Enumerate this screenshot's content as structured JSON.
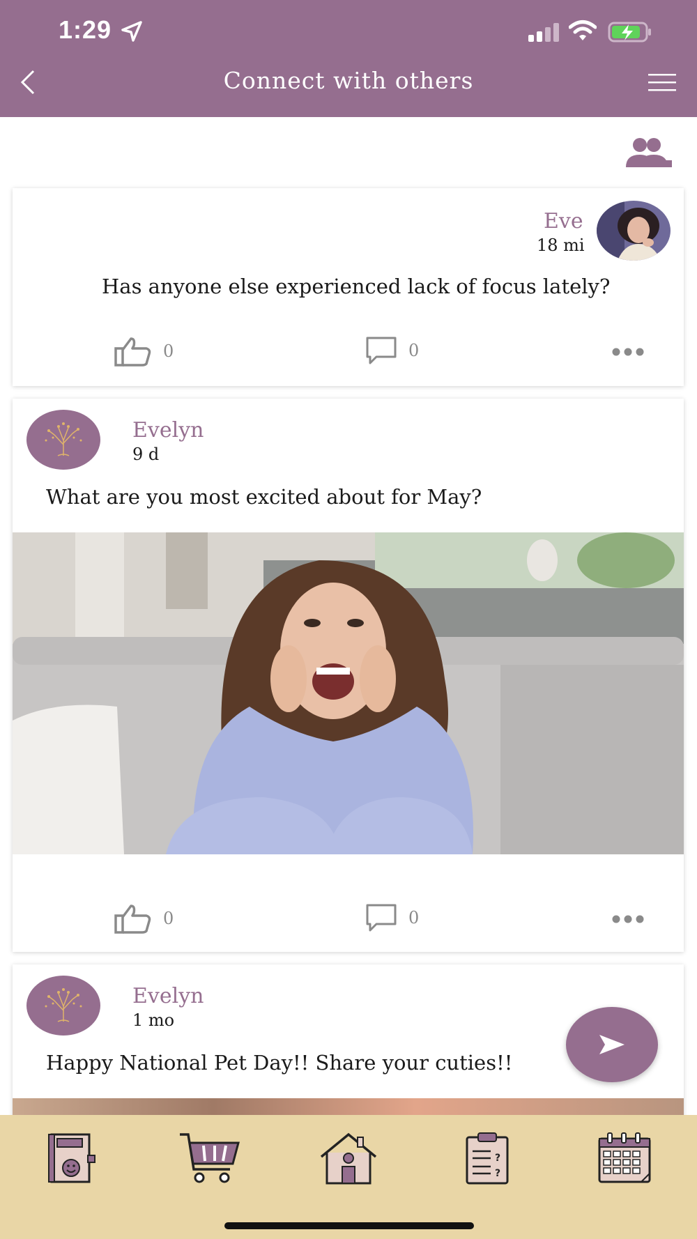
{
  "status_bar": {
    "time": "1:29"
  },
  "header": {
    "title": "Connect with others"
  },
  "posts": [
    {
      "author": "Eve",
      "meta": "18 mi",
      "text": "Has anyone else experienced lack of focus lately?",
      "likes": "0",
      "comments": "0"
    },
    {
      "author": "Evelyn",
      "meta": "9 d",
      "text": "What are you most excited about for May?",
      "likes": "0",
      "comments": "0"
    },
    {
      "author": "Evelyn",
      "meta": "1 mo",
      "text": "Happy National Pet Day!! Share your cuties!!"
    }
  ],
  "colors": {
    "brand": "#956e8f",
    "bottom_bar": "#e9d6a6"
  },
  "icons": {
    "back": "chevron-left-icon",
    "menu": "hamburger-menu-icon",
    "group": "people-icon",
    "like": "thumbs-up-icon",
    "comment": "comment-icon",
    "more": "more-dots-icon",
    "send": "send-icon",
    "tabs": [
      "journal-icon",
      "cart-icon",
      "home-icon",
      "quiz-clipboard-icon",
      "calendar-icon"
    ]
  }
}
